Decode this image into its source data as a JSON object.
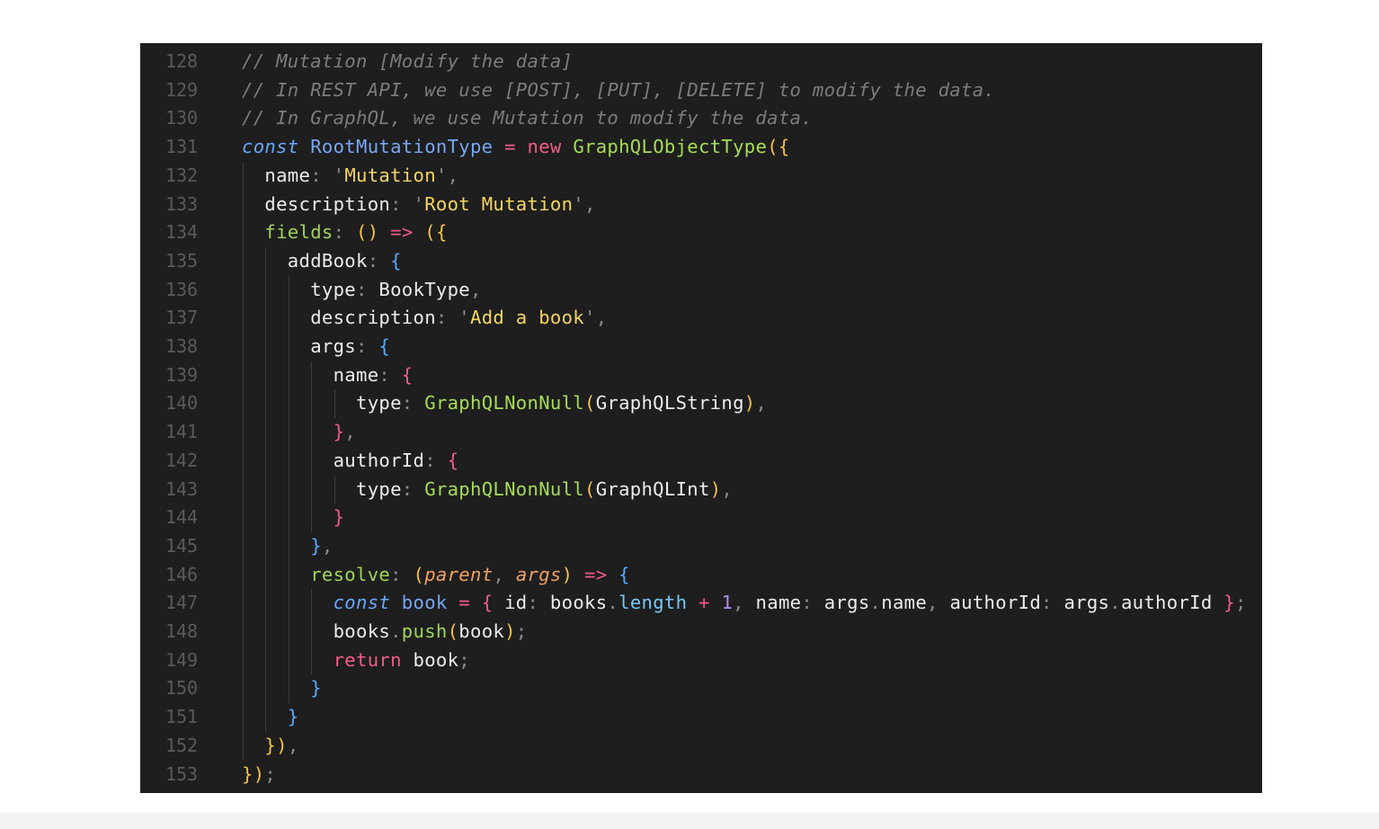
{
  "editor": {
    "lines": [
      {
        "n": "128",
        "tokens": [
          {
            "t": "// Mutation [Modify the data]",
            "c": "comment"
          }
        ]
      },
      {
        "n": "129",
        "tokens": [
          {
            "t": "// In REST API, we use [POST], [PUT], [DELETE] to modify the data.",
            "c": "comment"
          }
        ]
      },
      {
        "n": "130",
        "tokens": [
          {
            "t": "// In GraphQL, we use Mutation to modify the data.",
            "c": "comment"
          }
        ]
      },
      {
        "n": "131",
        "tokens": [
          {
            "t": "const",
            "c": "kw"
          },
          {
            "t": " ",
            "c": "plain"
          },
          {
            "t": "RootMutationType",
            "c": "var"
          },
          {
            "t": " = ",
            "c": "op"
          },
          {
            "t": "new",
            "c": "new"
          },
          {
            "t": " ",
            "c": "plain"
          },
          {
            "t": "GraphQLObjectType",
            "c": "fn"
          },
          {
            "t": "(",
            "c": "b1"
          },
          {
            "t": "{",
            "c": "b1"
          }
        ]
      },
      {
        "n": "132",
        "tokens": [
          {
            "t": "  ",
            "c": "plain"
          },
          {
            "t": "name",
            "c": "key"
          },
          {
            "t": ": ",
            "c": "punct"
          },
          {
            "t": "'",
            "c": "punct"
          },
          {
            "t": "Mutation",
            "c": "str"
          },
          {
            "t": "'",
            "c": "punct"
          },
          {
            "t": ",",
            "c": "punct"
          }
        ]
      },
      {
        "n": "133",
        "tokens": [
          {
            "t": "  ",
            "c": "plain"
          },
          {
            "t": "description",
            "c": "key"
          },
          {
            "t": ": ",
            "c": "punct"
          },
          {
            "t": "'",
            "c": "punct"
          },
          {
            "t": "Root Mutation",
            "c": "str"
          },
          {
            "t": "'",
            "c": "punct"
          },
          {
            "t": ",",
            "c": "punct"
          }
        ]
      },
      {
        "n": "134",
        "tokens": [
          {
            "t": "  ",
            "c": "plain"
          },
          {
            "t": "fields",
            "c": "method"
          },
          {
            "t": ": ",
            "c": "punct"
          },
          {
            "t": "()",
            "c": "b1"
          },
          {
            "t": " ",
            "c": "plain"
          },
          {
            "t": "=>",
            "c": "op"
          },
          {
            "t": " ",
            "c": "plain"
          },
          {
            "t": "(",
            "c": "b1"
          },
          {
            "t": "{",
            "c": "b1"
          }
        ]
      },
      {
        "n": "135",
        "tokens": [
          {
            "t": "    ",
            "c": "plain"
          },
          {
            "t": "addBook",
            "c": "key"
          },
          {
            "t": ": ",
            "c": "punct"
          },
          {
            "t": "{",
            "c": "b3"
          }
        ]
      },
      {
        "n": "136",
        "tokens": [
          {
            "t": "      ",
            "c": "plain"
          },
          {
            "t": "type",
            "c": "key"
          },
          {
            "t": ": ",
            "c": "punct"
          },
          {
            "t": "BookType",
            "c": "plain"
          },
          {
            "t": ",",
            "c": "punct"
          }
        ]
      },
      {
        "n": "137",
        "tokens": [
          {
            "t": "      ",
            "c": "plain"
          },
          {
            "t": "description",
            "c": "key"
          },
          {
            "t": ": ",
            "c": "punct"
          },
          {
            "t": "'",
            "c": "punct"
          },
          {
            "t": "Add a book",
            "c": "str"
          },
          {
            "t": "'",
            "c": "punct"
          },
          {
            "t": ",",
            "c": "punct"
          }
        ]
      },
      {
        "n": "138",
        "tokens": [
          {
            "t": "      ",
            "c": "plain"
          },
          {
            "t": "args",
            "c": "key"
          },
          {
            "t": ": ",
            "c": "punct"
          },
          {
            "t": "{",
            "c": "b3"
          }
        ]
      },
      {
        "n": "139",
        "tokens": [
          {
            "t": "        ",
            "c": "plain"
          },
          {
            "t": "name",
            "c": "key"
          },
          {
            "t": ": ",
            "c": "punct"
          },
          {
            "t": "{",
            "c": "b2"
          }
        ]
      },
      {
        "n": "140",
        "tokens": [
          {
            "t": "          ",
            "c": "plain"
          },
          {
            "t": "type",
            "c": "key"
          },
          {
            "t": ": ",
            "c": "punct"
          },
          {
            "t": "GraphQLNonNull",
            "c": "fn"
          },
          {
            "t": "(",
            "c": "b1"
          },
          {
            "t": "GraphQLString",
            "c": "plain"
          },
          {
            "t": ")",
            "c": "b1"
          },
          {
            "t": ",",
            "c": "punct"
          }
        ]
      },
      {
        "n": "141",
        "tokens": [
          {
            "t": "        ",
            "c": "plain"
          },
          {
            "t": "}",
            "c": "b2"
          },
          {
            "t": ",",
            "c": "punct"
          }
        ]
      },
      {
        "n": "142",
        "tokens": [
          {
            "t": "        ",
            "c": "plain"
          },
          {
            "t": "authorId",
            "c": "key"
          },
          {
            "t": ": ",
            "c": "punct"
          },
          {
            "t": "{",
            "c": "b2"
          }
        ]
      },
      {
        "n": "143",
        "tokens": [
          {
            "t": "          ",
            "c": "plain"
          },
          {
            "t": "type",
            "c": "key"
          },
          {
            "t": ": ",
            "c": "punct"
          },
          {
            "t": "GraphQLNonNull",
            "c": "fn"
          },
          {
            "t": "(",
            "c": "b1"
          },
          {
            "t": "GraphQLInt",
            "c": "plain"
          },
          {
            "t": ")",
            "c": "b1"
          },
          {
            "t": ",",
            "c": "punct"
          }
        ]
      },
      {
        "n": "144",
        "tokens": [
          {
            "t": "        ",
            "c": "plain"
          },
          {
            "t": "}",
            "c": "b2"
          }
        ]
      },
      {
        "n": "145",
        "tokens": [
          {
            "t": "      ",
            "c": "plain"
          },
          {
            "t": "}",
            "c": "b3"
          },
          {
            "t": ",",
            "c": "punct"
          }
        ]
      },
      {
        "n": "146",
        "tokens": [
          {
            "t": "      ",
            "c": "plain"
          },
          {
            "t": "resolve",
            "c": "method"
          },
          {
            "t": ": ",
            "c": "punct"
          },
          {
            "t": "(",
            "c": "b1"
          },
          {
            "t": "parent",
            "c": "param"
          },
          {
            "t": ", ",
            "c": "punct"
          },
          {
            "t": "args",
            "c": "param"
          },
          {
            "t": ")",
            "c": "b1"
          },
          {
            "t": " ",
            "c": "plain"
          },
          {
            "t": "=>",
            "c": "op"
          },
          {
            "t": " ",
            "c": "plain"
          },
          {
            "t": "{",
            "c": "b3"
          }
        ]
      },
      {
        "n": "147",
        "tokens": [
          {
            "t": "        ",
            "c": "plain"
          },
          {
            "t": "const",
            "c": "kw"
          },
          {
            "t": " ",
            "c": "plain"
          },
          {
            "t": "book",
            "c": "var"
          },
          {
            "t": " = ",
            "c": "op"
          },
          {
            "t": "{",
            "c": "b2"
          },
          {
            "t": " ",
            "c": "plain"
          },
          {
            "t": "id",
            "c": "key"
          },
          {
            "t": ": ",
            "c": "punct"
          },
          {
            "t": "books",
            "c": "plain"
          },
          {
            "t": ".",
            "c": "punct"
          },
          {
            "t": "length",
            "c": "prop"
          },
          {
            "t": " + ",
            "c": "op"
          },
          {
            "t": "1",
            "c": "num"
          },
          {
            "t": ", ",
            "c": "punct"
          },
          {
            "t": "name",
            "c": "key"
          },
          {
            "t": ": ",
            "c": "punct"
          },
          {
            "t": "args",
            "c": "plain"
          },
          {
            "t": ".",
            "c": "punct"
          },
          {
            "t": "name",
            "c": "plain"
          },
          {
            "t": ", ",
            "c": "punct"
          },
          {
            "t": "authorId",
            "c": "key"
          },
          {
            "t": ": ",
            "c": "punct"
          },
          {
            "t": "args",
            "c": "plain"
          },
          {
            "t": ".",
            "c": "punct"
          },
          {
            "t": "authorId",
            "c": "plain"
          },
          {
            "t": " ",
            "c": "plain"
          },
          {
            "t": "}",
            "c": "b2"
          },
          {
            "t": ";",
            "c": "punct"
          }
        ]
      },
      {
        "n": "148",
        "tokens": [
          {
            "t": "        ",
            "c": "plain"
          },
          {
            "t": "books",
            "c": "plain"
          },
          {
            "t": ".",
            "c": "punct"
          },
          {
            "t": "push",
            "c": "method"
          },
          {
            "t": "(",
            "c": "b1"
          },
          {
            "t": "book",
            "c": "plain"
          },
          {
            "t": ")",
            "c": "b1"
          },
          {
            "t": ";",
            "c": "punct"
          }
        ]
      },
      {
        "n": "149",
        "tokens": [
          {
            "t": "        ",
            "c": "plain"
          },
          {
            "t": "return",
            "c": "ret"
          },
          {
            "t": " ",
            "c": "plain"
          },
          {
            "t": "book",
            "c": "plain"
          },
          {
            "t": ";",
            "c": "punct"
          }
        ]
      },
      {
        "n": "150",
        "tokens": [
          {
            "t": "      ",
            "c": "plain"
          },
          {
            "t": "}",
            "c": "b3"
          }
        ]
      },
      {
        "n": "151",
        "tokens": [
          {
            "t": "    ",
            "c": "plain"
          },
          {
            "t": "}",
            "c": "b3"
          }
        ]
      },
      {
        "n": "152",
        "tokens": [
          {
            "t": "  ",
            "c": "plain"
          },
          {
            "t": "}",
            "c": "b1"
          },
          {
            "t": ")",
            "c": "b1"
          },
          {
            "t": ",",
            "c": "punct"
          }
        ]
      },
      {
        "n": "153",
        "tokens": [
          {
            "t": "}",
            "c": "b1"
          },
          {
            "t": ")",
            "c": "b1"
          },
          {
            "t": ";",
            "c": "punct"
          }
        ]
      }
    ]
  }
}
